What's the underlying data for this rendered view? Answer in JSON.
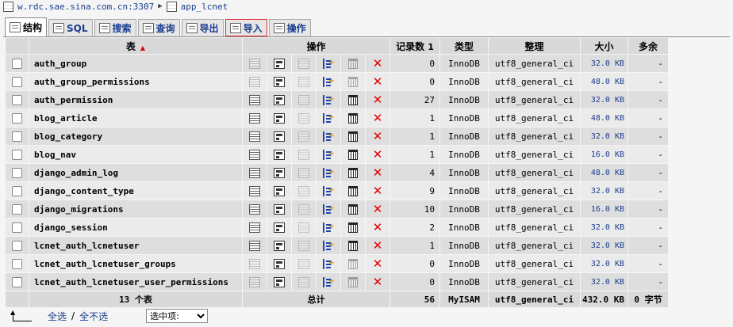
{
  "breadcrumb": {
    "server": "w.rdc.sae.sina.com.cn:3307",
    "separator": "▶",
    "database": "app_lcnet"
  },
  "tabs": [
    {
      "label": "结构",
      "icon": "structure-icon",
      "active": true
    },
    {
      "label": "SQL",
      "icon": "sql-icon"
    },
    {
      "label": "搜索",
      "icon": "search-icon"
    },
    {
      "label": "查询",
      "icon": "query-icon"
    },
    {
      "label": "导出",
      "icon": "export-icon"
    },
    {
      "label": "导入",
      "icon": "import-icon",
      "highlighted": true
    },
    {
      "label": "操作",
      "icon": "wrench-icon"
    }
  ],
  "table": {
    "headers": {
      "table": "表",
      "sort_arrow": "▲",
      "actions": "操作",
      "records": "记录数",
      "records_badge": "1",
      "type": "类型",
      "collation": "整理",
      "size": "大小",
      "overhead": "多余"
    },
    "rows": [
      {
        "name": "auth_group",
        "records": "0",
        "type": "InnoDB",
        "collation": "utf8_general_ci",
        "size": "32.0 KB",
        "overhead": "-",
        "empty": true
      },
      {
        "name": "auth_group_permissions",
        "records": "0",
        "type": "InnoDB",
        "collation": "utf8_general_ci",
        "size": "48.0 KB",
        "overhead": "-",
        "empty": true
      },
      {
        "name": "auth_permission",
        "records": "27",
        "type": "InnoDB",
        "collation": "utf8_general_ci",
        "size": "32.0 KB",
        "overhead": "-",
        "empty": false
      },
      {
        "name": "blog_article",
        "records": "1",
        "type": "InnoDB",
        "collation": "utf8_general_ci",
        "size": "48.0 KB",
        "overhead": "-",
        "empty": false
      },
      {
        "name": "blog_category",
        "records": "1",
        "type": "InnoDB",
        "collation": "utf8_general_ci",
        "size": "32.0 KB",
        "overhead": "-",
        "empty": false
      },
      {
        "name": "blog_nav",
        "records": "1",
        "type": "InnoDB",
        "collation": "utf8_general_ci",
        "size": "16.0 KB",
        "overhead": "-",
        "empty": false
      },
      {
        "name": "django_admin_log",
        "records": "4",
        "type": "InnoDB",
        "collation": "utf8_general_ci",
        "size": "48.0 KB",
        "overhead": "-",
        "empty": false
      },
      {
        "name": "django_content_type",
        "records": "9",
        "type": "InnoDB",
        "collation": "utf8_general_ci",
        "size": "32.0 KB",
        "overhead": "-",
        "empty": false
      },
      {
        "name": "django_migrations",
        "records": "10",
        "type": "InnoDB",
        "collation": "utf8_general_ci",
        "size": "16.0 KB",
        "overhead": "-",
        "empty": false
      },
      {
        "name": "django_session",
        "records": "2",
        "type": "InnoDB",
        "collation": "utf8_general_ci",
        "size": "32.0 KB",
        "overhead": "-",
        "empty": false
      },
      {
        "name": "lcnet_auth_lcnetuser",
        "records": "1",
        "type": "InnoDB",
        "collation": "utf8_general_ci",
        "size": "32.0 KB",
        "overhead": "-",
        "empty": false
      },
      {
        "name": "lcnet_auth_lcnetuser_groups",
        "records": "0",
        "type": "InnoDB",
        "collation": "utf8_general_ci",
        "size": "32.0 KB",
        "overhead": "-",
        "empty": true
      },
      {
        "name": "lcnet_auth_lcnetuser_user_permissions",
        "records": "0",
        "type": "InnoDB",
        "collation": "utf8_general_ci",
        "size": "32.0 KB",
        "overhead": "-",
        "empty": true
      }
    ],
    "footer": {
      "count": "13 个表",
      "total_label": "总计",
      "records": "56",
      "type": "MyISAM",
      "collation": "utf8_general_ci",
      "size": "432.0 KB",
      "overhead": "0 字节"
    }
  },
  "bottom": {
    "arrow": "▲",
    "select_all": "全选",
    "slash": "/",
    "deselect_all": "全不选",
    "with_selected": "选中项:"
  }
}
